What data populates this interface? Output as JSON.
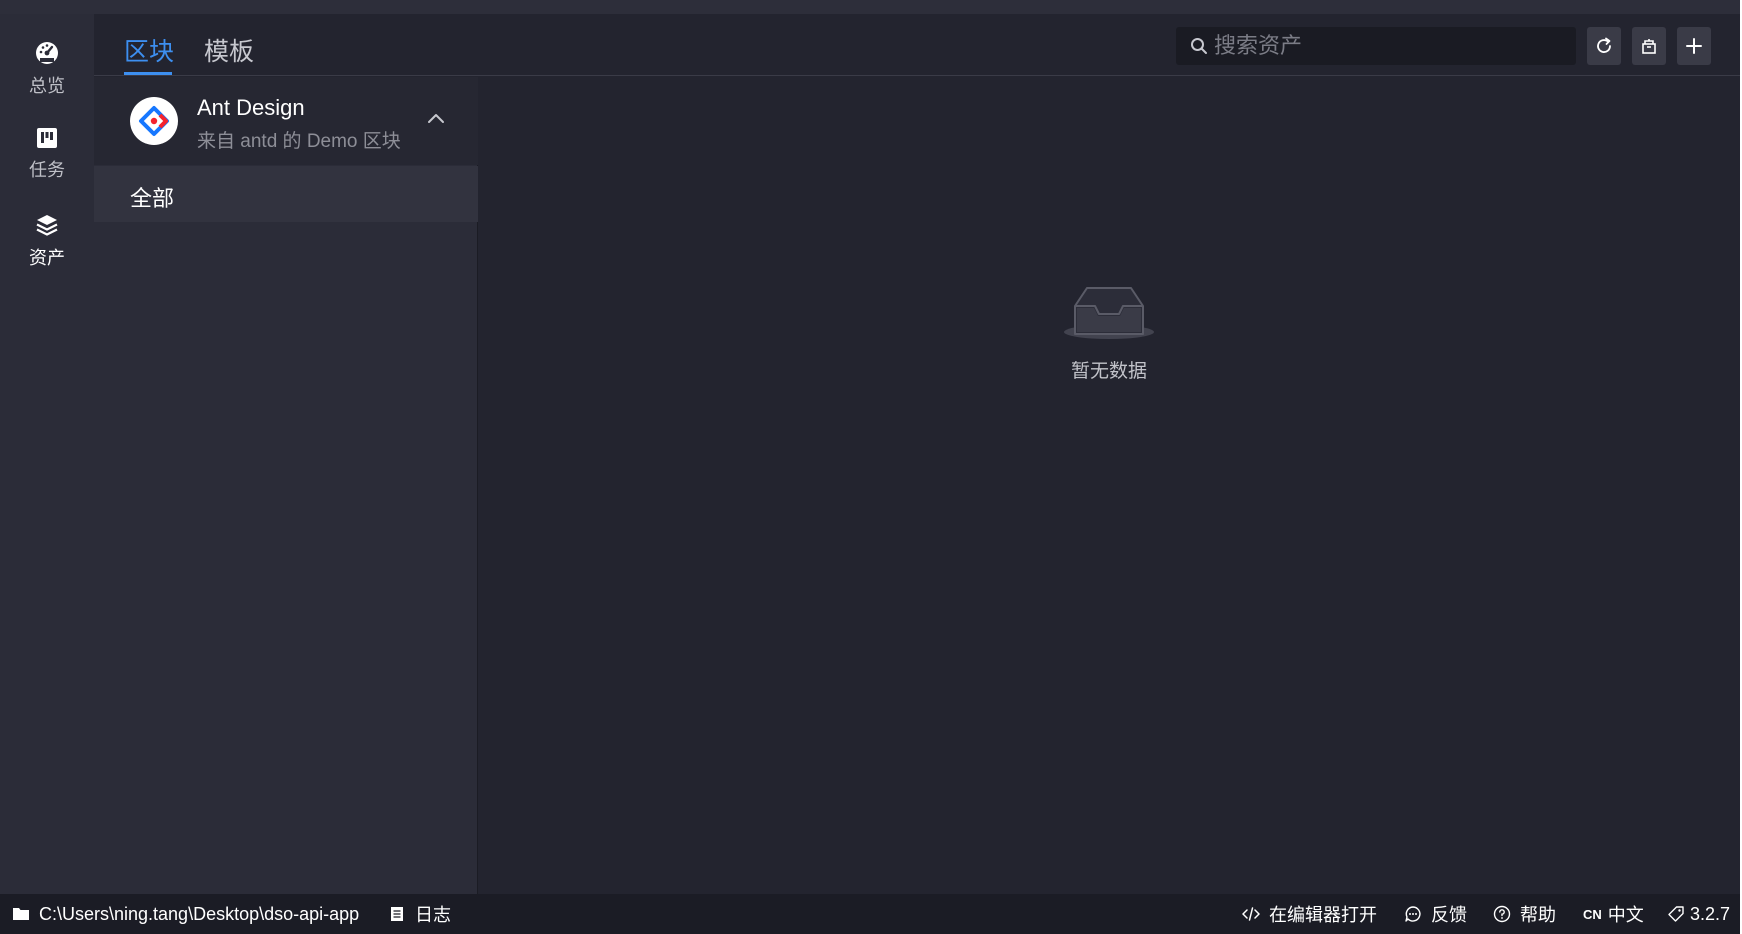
{
  "nav": {
    "items": [
      {
        "label": "总览",
        "icon": "dashboard-icon"
      },
      {
        "label": "任务",
        "icon": "task-board-icon"
      },
      {
        "label": "资产",
        "icon": "layers-icon"
      }
    ],
    "active": "资产"
  },
  "header": {
    "tabs": [
      {
        "label": "区块"
      },
      {
        "label": "模板"
      }
    ],
    "active_tab": "区块",
    "search": {
      "placeholder": "搜索资产",
      "value": ""
    },
    "buttons": [
      {
        "icon": "refresh-icon"
      },
      {
        "icon": "package-icon"
      },
      {
        "icon": "plus-icon"
      }
    ]
  },
  "sidebar": {
    "group": {
      "title": "Ant Design",
      "subtitle": "来自 antd 的 Demo 区块",
      "logo": "ant-design-logo",
      "expanded": true
    },
    "categories": [
      {
        "label": "全部",
        "selected": true
      }
    ]
  },
  "main": {
    "empty_text": "暂无数据"
  },
  "status_bar": {
    "path": "C:\\Users\\ning.tang\\Desktop\\dso-api-app",
    "log": "日志",
    "open_in_editor": "在编辑器打开",
    "feedback": "反馈",
    "help": "帮助",
    "lang_code": "CN",
    "lang": "中文",
    "version": "3.2.7"
  },
  "colors": {
    "accent": "#3d8ff0",
    "background": "#23242f",
    "panel": "#2b2c38",
    "statusbar": "#1b1c25"
  }
}
